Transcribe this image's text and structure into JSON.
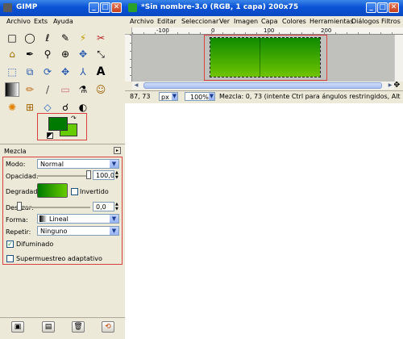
{
  "toolbox": {
    "title": "GIMP",
    "menu": [
      "Archivo",
      "Exts",
      "Ayuda"
    ],
    "tools_row1": [
      "□",
      "◯",
      "ℓ",
      "✎",
      "⚡",
      "✂"
    ],
    "tools_row2": [
      "⌂",
      "✒",
      "⚲",
      "⊕",
      "✥",
      "⤡"
    ],
    "tools_row3": [
      "⬚",
      "⧉",
      "⟳",
      "✥",
      "⅄",
      "A"
    ],
    "tools_row4": [
      "▣",
      "✏",
      "/",
      "▭",
      "⚗",
      "☺"
    ],
    "tools_row5": [
      "✺",
      "⊞",
      "◇",
      "☌",
      "◐"
    ],
    "colors": {
      "fg": "#007a00",
      "bg": "#66cc00"
    }
  },
  "options": {
    "title": "Mezcla",
    "mode_label": "Modo:",
    "mode_value": "Normal",
    "opacity_label": "Opacidad:",
    "opacity_value": "100,0",
    "gradient_label": "Degradado:",
    "inverted_label": "Invertido",
    "offset_label": "Deslizar:",
    "offset_value": "0,0",
    "shape_label": "Forma:",
    "shape_value": "Lineal",
    "repeat_label": "Repetir:",
    "repeat_value": "Ninguno",
    "dither_label": "Difuminado",
    "supersample_label": "Supermuestreo adaptativo"
  },
  "image_window": {
    "title": "*Sin nombre-3.0 (RGB, 1 capa) 200x75",
    "menu": [
      "Archivo",
      "Editar",
      "Seleccionar",
      "Ver",
      "Imagen",
      "Capa",
      "Colores",
      "Herramientas",
      "Diálogos",
      "Filtros"
    ],
    "ruler_ticks": [
      "-100",
      "0",
      "100",
      "200"
    ],
    "coords": "87, 73",
    "unit": "px",
    "zoom": "100%",
    "status": "Mezcla: 0, 73 (intente Ctrl para ángulos restringidos, Alt para mover..."
  },
  "colors": {
    "gradient_start": "#0f8b00",
    "gradient_end": "#6fc400",
    "highlight": "#d94040"
  }
}
